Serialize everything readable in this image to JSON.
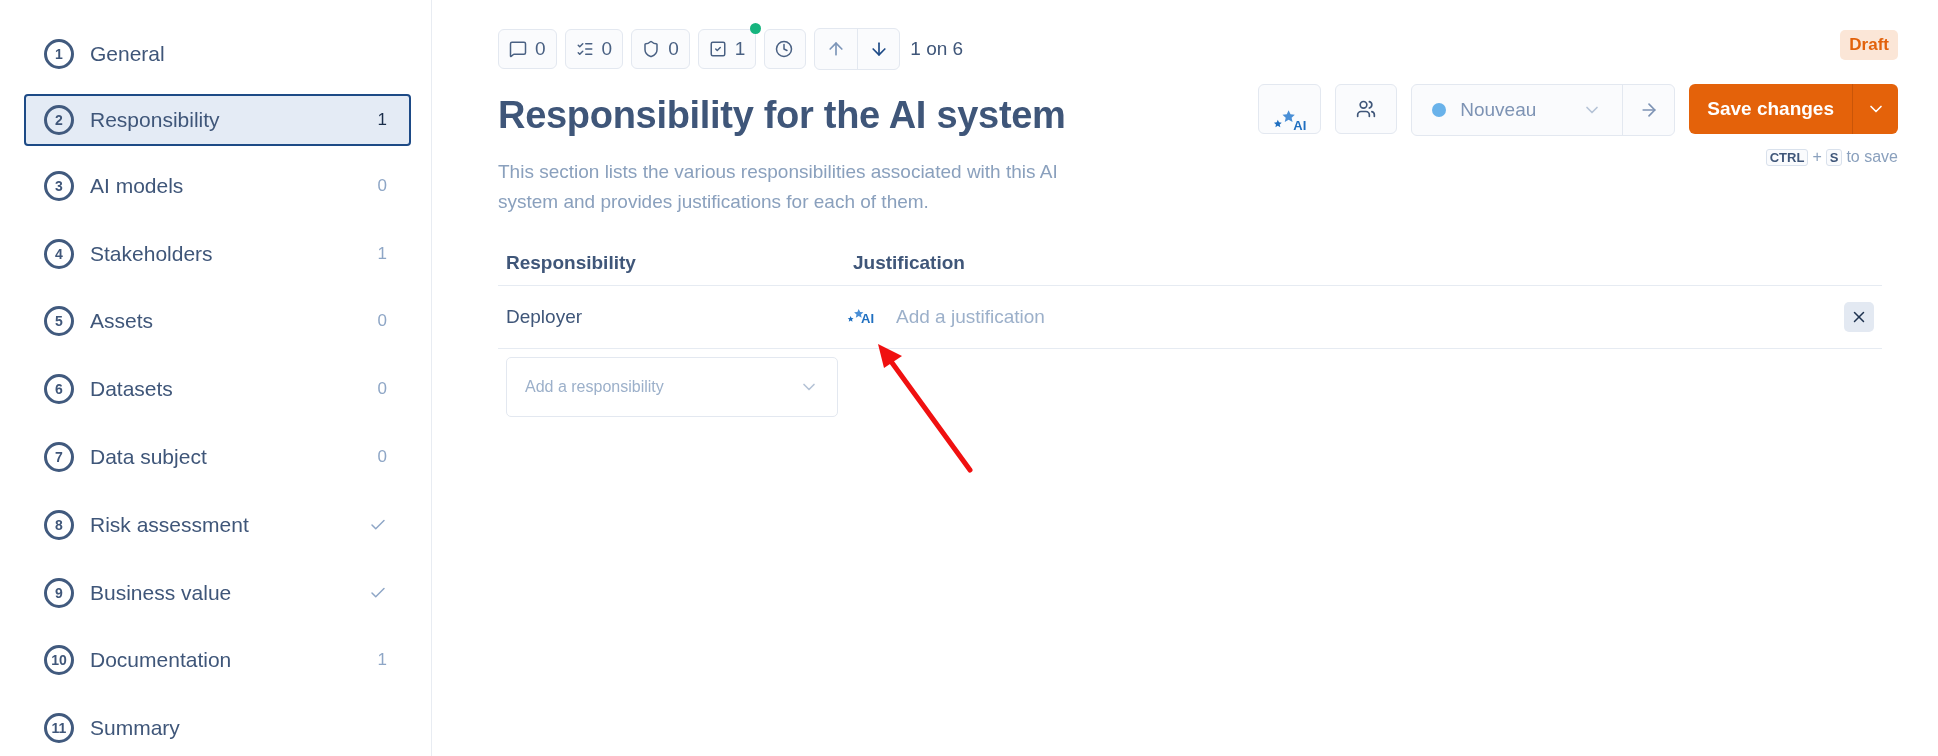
{
  "sidebar": {
    "items": [
      {
        "number": "1",
        "label": "General",
        "kind": "plain",
        "selected": false
      },
      {
        "number": "2",
        "label": "Responsibility",
        "kind": "count",
        "count": "1",
        "selected": true
      },
      {
        "number": "3",
        "label": "AI models",
        "kind": "count",
        "count": "0",
        "selected": false
      },
      {
        "number": "4",
        "label": "Stakeholders",
        "kind": "count",
        "count": "1",
        "selected": false
      },
      {
        "number": "5",
        "label": "Assets",
        "kind": "count",
        "count": "0",
        "selected": false
      },
      {
        "number": "6",
        "label": "Datasets",
        "kind": "count",
        "count": "0",
        "selected": false
      },
      {
        "number": "7",
        "label": "Data subject",
        "kind": "count",
        "count": "0",
        "selected": false
      },
      {
        "number": "8",
        "label": "Risk assessment",
        "kind": "check",
        "selected": false
      },
      {
        "number": "9",
        "label": "Business value",
        "kind": "check",
        "selected": false
      },
      {
        "number": "10",
        "label": "Documentation",
        "kind": "count",
        "count": "1",
        "selected": false
      },
      {
        "number": "11",
        "label": "Summary",
        "kind": "plain",
        "selected": false
      }
    ]
  },
  "toolbar": {
    "counters": [
      {
        "kind": "comment",
        "count": "0",
        "notification": false
      },
      {
        "kind": "checklist",
        "count": "0",
        "notification": false
      },
      {
        "kind": "shield",
        "count": "0",
        "notification": false
      },
      {
        "kind": "task",
        "count": "1",
        "notification": true
      }
    ],
    "nav": [
      {
        "kind": "up",
        "disabled": true
      },
      {
        "kind": "down",
        "disabled": false
      }
    ],
    "position": "1 on 6"
  },
  "header": {
    "status_badge": "Draft",
    "title": "Responsibility for the AI system",
    "description": "This section lists the various responsibilities associated with this AI system and provides justifications for each of them.",
    "ai_button_label": "AI",
    "status_select": {
      "value": "Nouveau"
    },
    "save_button": "Save changes",
    "shortcut": {
      "keys": [
        "CTRL",
        "S"
      ],
      "separator": "+",
      "suffix": "to save"
    }
  },
  "table": {
    "columns": [
      "Responsibility",
      "Justification"
    ],
    "rows": [
      {
        "responsibility": "Deployer",
        "ai_label": "AI",
        "placeholder": "Add a justification"
      }
    ],
    "add_select": {
      "placeholder": "Add a responsibility"
    }
  }
}
